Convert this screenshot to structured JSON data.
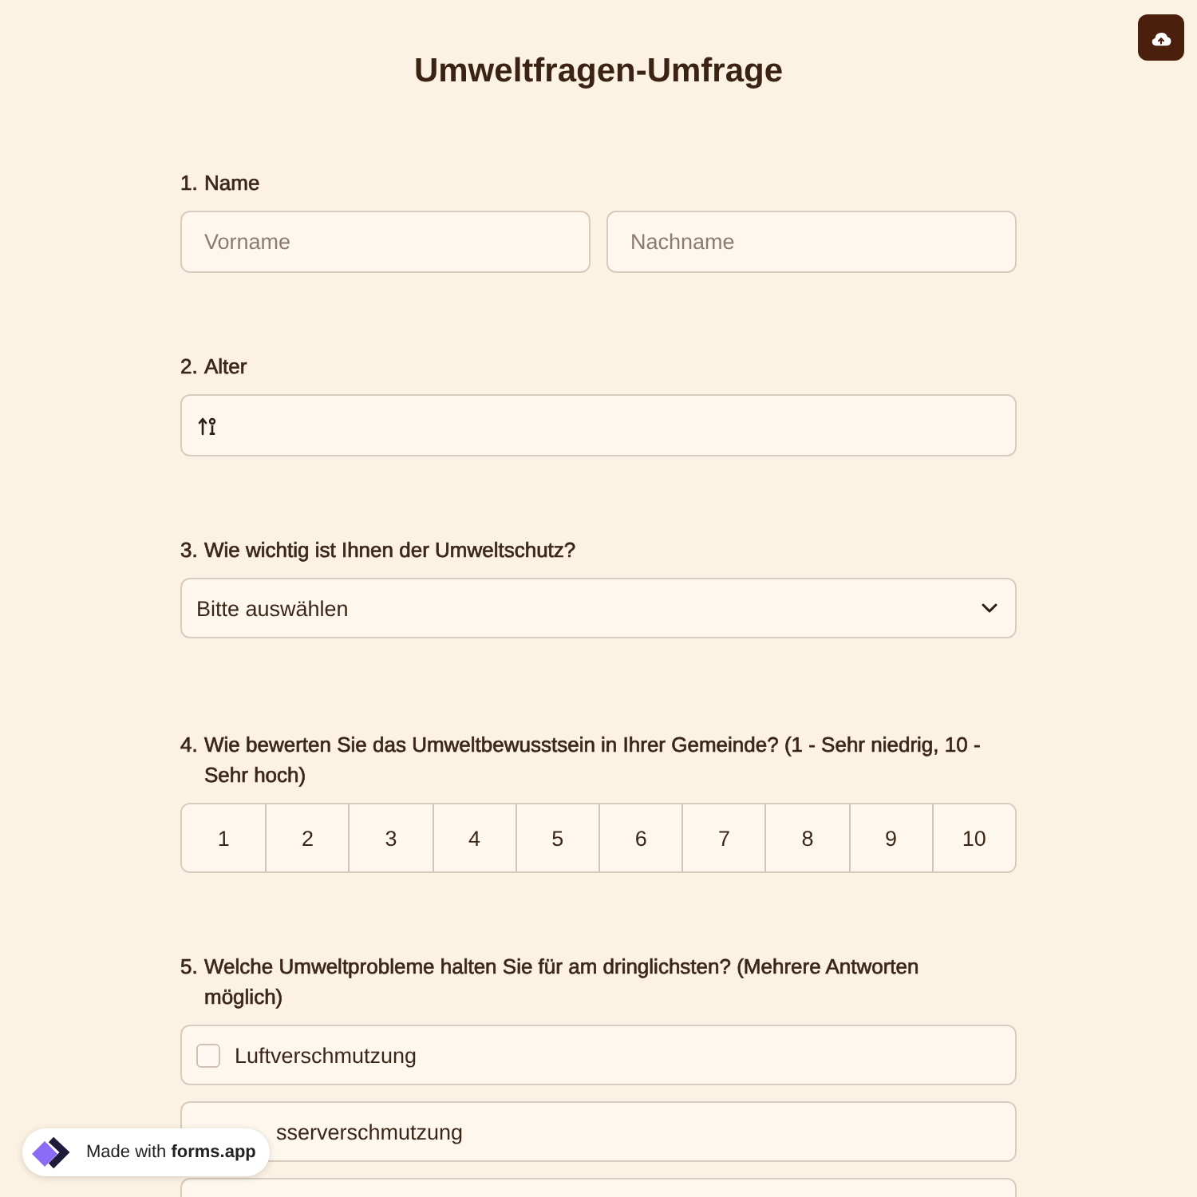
{
  "title": "Umweltfragen-Umfrage",
  "questions": [
    {
      "number": "1.",
      "title": "Name",
      "kind": "name",
      "fields": [
        {
          "placeholder": "Vorname"
        },
        {
          "placeholder": "Nachname"
        }
      ]
    },
    {
      "number": "2.",
      "title": "Alter",
      "kind": "number"
    },
    {
      "number": "3.",
      "title": "Wie wichtig ist Ihnen der Umweltschutz?",
      "kind": "dropdown",
      "value": "Bitte auswählen"
    },
    {
      "number": "4.",
      "title": "Wie bewerten Sie das Umweltbewusstsein in Ihrer Gemeinde? (1 - Sehr niedrig, 10 - Sehr hoch)",
      "kind": "scale",
      "options": [
        {
          "label": "1",
          "selected": false
        },
        {
          "label": "2",
          "selected": false
        },
        {
          "label": "3",
          "selected": false
        },
        {
          "label": "4",
          "selected": false
        },
        {
          "label": "5",
          "selected": false
        },
        {
          "label": "6",
          "selected": false
        },
        {
          "label": "7",
          "selected": false
        },
        {
          "label": "8",
          "selected": false
        },
        {
          "label": "9",
          "selected": false
        },
        {
          "label": "10",
          "selected": false
        }
      ]
    },
    {
      "number": "5.",
      "title": "Welche Umweltprobleme halten Sie für am dringlichsten? (Mehrere Antworten möglich)",
      "kind": "checkboxes",
      "options": [
        {
          "label": "Luftverschmutzung",
          "checked": false
        },
        {
          "label": "sserverschmutzung"
        }
      ],
      "more_options_below": true
    }
  ],
  "badge": {
    "text": "Made with **forms.app**"
  }
}
